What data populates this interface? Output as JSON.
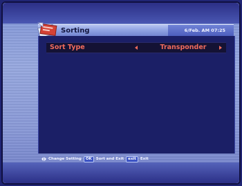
{
  "header": {
    "title": "Sorting",
    "datetime": "6/Feb. AM 07:25",
    "icon": "sort-menu-icon"
  },
  "menu": {
    "items": [
      {
        "label": "Sort Type",
        "value": "Transponder"
      }
    ]
  },
  "help": {
    "change_label": "Change Setting",
    "ok_key": "OK",
    "ok_label": "Sort and Exit",
    "exit_key": "exit",
    "exit_label": "Exit"
  },
  "colors": {
    "highlight_text": "#f06b5c",
    "panel_background": "#1b1f66",
    "title_bar": "#8c9fe0",
    "screen_background": "#96a7de"
  }
}
